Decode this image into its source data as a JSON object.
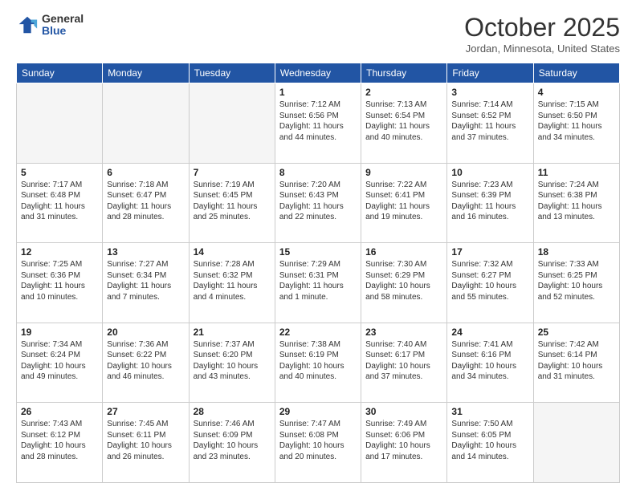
{
  "header": {
    "logo_general": "General",
    "logo_blue": "Blue",
    "title": "October 2025",
    "location": "Jordan, Minnesota, United States"
  },
  "days_of_week": [
    "Sunday",
    "Monday",
    "Tuesday",
    "Wednesday",
    "Thursday",
    "Friday",
    "Saturday"
  ],
  "weeks": [
    [
      {
        "day": "",
        "info": ""
      },
      {
        "day": "",
        "info": ""
      },
      {
        "day": "",
        "info": ""
      },
      {
        "day": "1",
        "info": "Sunrise: 7:12 AM\nSunset: 6:56 PM\nDaylight: 11 hours\nand 44 minutes."
      },
      {
        "day": "2",
        "info": "Sunrise: 7:13 AM\nSunset: 6:54 PM\nDaylight: 11 hours\nand 40 minutes."
      },
      {
        "day": "3",
        "info": "Sunrise: 7:14 AM\nSunset: 6:52 PM\nDaylight: 11 hours\nand 37 minutes."
      },
      {
        "day": "4",
        "info": "Sunrise: 7:15 AM\nSunset: 6:50 PM\nDaylight: 11 hours\nand 34 minutes."
      }
    ],
    [
      {
        "day": "5",
        "info": "Sunrise: 7:17 AM\nSunset: 6:48 PM\nDaylight: 11 hours\nand 31 minutes."
      },
      {
        "day": "6",
        "info": "Sunrise: 7:18 AM\nSunset: 6:47 PM\nDaylight: 11 hours\nand 28 minutes."
      },
      {
        "day": "7",
        "info": "Sunrise: 7:19 AM\nSunset: 6:45 PM\nDaylight: 11 hours\nand 25 minutes."
      },
      {
        "day": "8",
        "info": "Sunrise: 7:20 AM\nSunset: 6:43 PM\nDaylight: 11 hours\nand 22 minutes."
      },
      {
        "day": "9",
        "info": "Sunrise: 7:22 AM\nSunset: 6:41 PM\nDaylight: 11 hours\nand 19 minutes."
      },
      {
        "day": "10",
        "info": "Sunrise: 7:23 AM\nSunset: 6:39 PM\nDaylight: 11 hours\nand 16 minutes."
      },
      {
        "day": "11",
        "info": "Sunrise: 7:24 AM\nSunset: 6:38 PM\nDaylight: 11 hours\nand 13 minutes."
      }
    ],
    [
      {
        "day": "12",
        "info": "Sunrise: 7:25 AM\nSunset: 6:36 PM\nDaylight: 11 hours\nand 10 minutes."
      },
      {
        "day": "13",
        "info": "Sunrise: 7:27 AM\nSunset: 6:34 PM\nDaylight: 11 hours\nand 7 minutes."
      },
      {
        "day": "14",
        "info": "Sunrise: 7:28 AM\nSunset: 6:32 PM\nDaylight: 11 hours\nand 4 minutes."
      },
      {
        "day": "15",
        "info": "Sunrise: 7:29 AM\nSunset: 6:31 PM\nDaylight: 11 hours\nand 1 minute."
      },
      {
        "day": "16",
        "info": "Sunrise: 7:30 AM\nSunset: 6:29 PM\nDaylight: 10 hours\nand 58 minutes."
      },
      {
        "day": "17",
        "info": "Sunrise: 7:32 AM\nSunset: 6:27 PM\nDaylight: 10 hours\nand 55 minutes."
      },
      {
        "day": "18",
        "info": "Sunrise: 7:33 AM\nSunset: 6:25 PM\nDaylight: 10 hours\nand 52 minutes."
      }
    ],
    [
      {
        "day": "19",
        "info": "Sunrise: 7:34 AM\nSunset: 6:24 PM\nDaylight: 10 hours\nand 49 minutes."
      },
      {
        "day": "20",
        "info": "Sunrise: 7:36 AM\nSunset: 6:22 PM\nDaylight: 10 hours\nand 46 minutes."
      },
      {
        "day": "21",
        "info": "Sunrise: 7:37 AM\nSunset: 6:20 PM\nDaylight: 10 hours\nand 43 minutes."
      },
      {
        "day": "22",
        "info": "Sunrise: 7:38 AM\nSunset: 6:19 PM\nDaylight: 10 hours\nand 40 minutes."
      },
      {
        "day": "23",
        "info": "Sunrise: 7:40 AM\nSunset: 6:17 PM\nDaylight: 10 hours\nand 37 minutes."
      },
      {
        "day": "24",
        "info": "Sunrise: 7:41 AM\nSunset: 6:16 PM\nDaylight: 10 hours\nand 34 minutes."
      },
      {
        "day": "25",
        "info": "Sunrise: 7:42 AM\nSunset: 6:14 PM\nDaylight: 10 hours\nand 31 minutes."
      }
    ],
    [
      {
        "day": "26",
        "info": "Sunrise: 7:43 AM\nSunset: 6:12 PM\nDaylight: 10 hours\nand 28 minutes."
      },
      {
        "day": "27",
        "info": "Sunrise: 7:45 AM\nSunset: 6:11 PM\nDaylight: 10 hours\nand 26 minutes."
      },
      {
        "day": "28",
        "info": "Sunrise: 7:46 AM\nSunset: 6:09 PM\nDaylight: 10 hours\nand 23 minutes."
      },
      {
        "day": "29",
        "info": "Sunrise: 7:47 AM\nSunset: 6:08 PM\nDaylight: 10 hours\nand 20 minutes."
      },
      {
        "day": "30",
        "info": "Sunrise: 7:49 AM\nSunset: 6:06 PM\nDaylight: 10 hours\nand 17 minutes."
      },
      {
        "day": "31",
        "info": "Sunrise: 7:50 AM\nSunset: 6:05 PM\nDaylight: 10 hours\nand 14 minutes."
      },
      {
        "day": "",
        "info": ""
      }
    ]
  ]
}
